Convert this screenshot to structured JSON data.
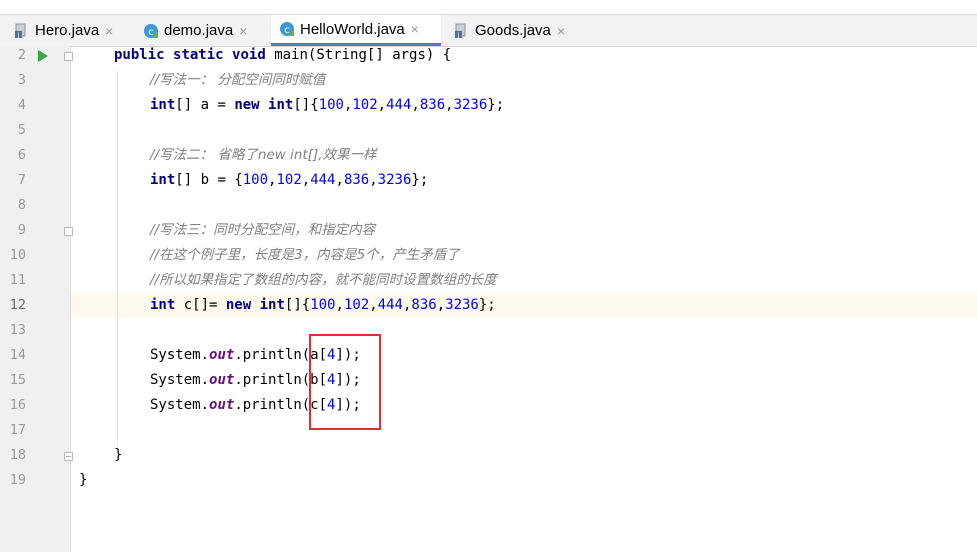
{
  "tabs": [
    {
      "name": "Hero.java",
      "icon": "java-file-icon",
      "active": false
    },
    {
      "name": "demo.java",
      "icon": "java-class-icon",
      "active": false
    },
    {
      "name": "HelloWorld.java",
      "icon": "java-class-icon",
      "active": true
    },
    {
      "name": "Goods.java",
      "icon": "java-file-icon",
      "active": false
    }
  ],
  "close_glyph": "×",
  "line_numbers": [
    "2",
    "3",
    "4",
    "5",
    "6",
    "7",
    "8",
    "9",
    "10",
    "11",
    "12",
    "13",
    "14",
    "15",
    "16",
    "17",
    "18",
    "19"
  ],
  "current_line": "12",
  "code": {
    "l2": {
      "kw1": "public",
      "kw2": "static",
      "kw3": "void",
      "rest": "main(String[] args) {"
    },
    "l3": {
      "comment": "//写法一： 分配空间同时赋值"
    },
    "l4": {
      "kw1": "int",
      "t1": "[] a = ",
      "kw2": "new",
      "kw3": "int",
      "t2": "[]{",
      "n1": "100",
      "n2": "102",
      "n3": "444",
      "n4": "836",
      "n5": "3236",
      "t3": "};"
    },
    "l6": {
      "comment": "//写法二： 省略了new int[],效果一样"
    },
    "l7": {
      "kw1": "int",
      "t1": "[] b = {",
      "n1": "100",
      "n2": "102",
      "n3": "444",
      "n4": "836",
      "n5": "3236",
      "t3": "};"
    },
    "l9": {
      "comment": "//写法三：同时分配空间，和指定内容"
    },
    "l10": {
      "comment": "//在这个例子里，长度是3，内容是5个，产生矛盾了"
    },
    "l11": {
      "comment": "//所以如果指定了数组的内容，就不能同时设置数组的长度"
    },
    "l12": {
      "kw1": "int",
      "t1": " c[]= ",
      "kw2": "new",
      "kw3": "int",
      "t2": "[]{",
      "n1": "100",
      "n2": "102",
      "n3": "444",
      "n4": "836",
      "n5": "3236",
      "t3": "};"
    },
    "l14": {
      "cls": "System.",
      "fld": "out",
      "call": ".println(a[",
      "idx": "4",
      "end": "]);"
    },
    "l15": {
      "cls": "System.",
      "fld": "out",
      "call": ".println(b[",
      "idx": "4",
      "end": "]);"
    },
    "l16": {
      "cls": "System.",
      "fld": "out",
      "call": ".println(c[",
      "idx": "4",
      "end": "]);"
    },
    "l18": {
      "text": "}"
    },
    "l19": {
      "text": "}"
    }
  },
  "colors": {
    "keyword": "#000080",
    "number": "#0000ff",
    "comment": "#808080",
    "field": "#660e7a",
    "run": "#3ea542",
    "highlight_box": "#e02d2d",
    "caret_line": "#fcfaed",
    "tab_underline": "#4083c9"
  }
}
